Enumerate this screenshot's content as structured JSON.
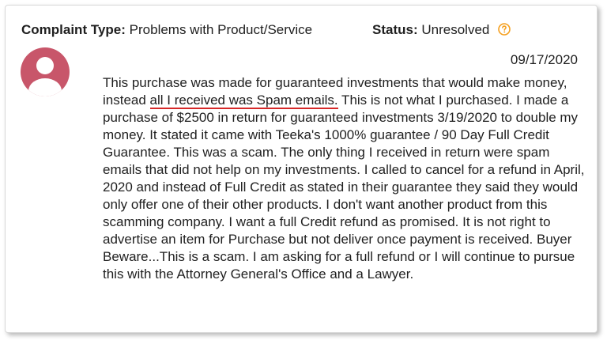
{
  "complaint": {
    "type_label": "Complaint Type:",
    "type_value": "Problems with Product/Service",
    "status_label": "Status:",
    "status_value": "Unresolved",
    "date": "09/17/2020",
    "text_before_highlight": "This purchase was made for guaranteed investments that would make money, instead ",
    "text_highlight": "all I received was Spam emails.",
    "text_after_highlight": " This is not what I purchased. I made a purchase of $2500 in return for guaranteed investments 3/19/2020 to double my money. It stated it came with Teeka's 1000% guarantee / 90 Day Full Credit Guarantee. This was a scam. The only thing I received in return were spam emails that did not help on my investments. I called to cancel for a refund in April, 2020 and instead of Full Credit as stated in their guarantee they said they would only offer one of their other products. I don't want another product from this scamming company. I want a full Credit refund as promised. It is not right to advertise an item for Purchase but not deliver once payment is received. Buyer Beware...This is a scam. I am asking for a full refund or I will continue to pursue this with the Attorney General's Office and a Lawyer."
  },
  "icons": {
    "avatar": "user-avatar-icon",
    "help": "question-circle-icon"
  },
  "colors": {
    "avatar_pink": "#c8566a",
    "help_orange": "#f5a020",
    "highlight_red": "#d62828",
    "text": "#1f1f1f"
  }
}
